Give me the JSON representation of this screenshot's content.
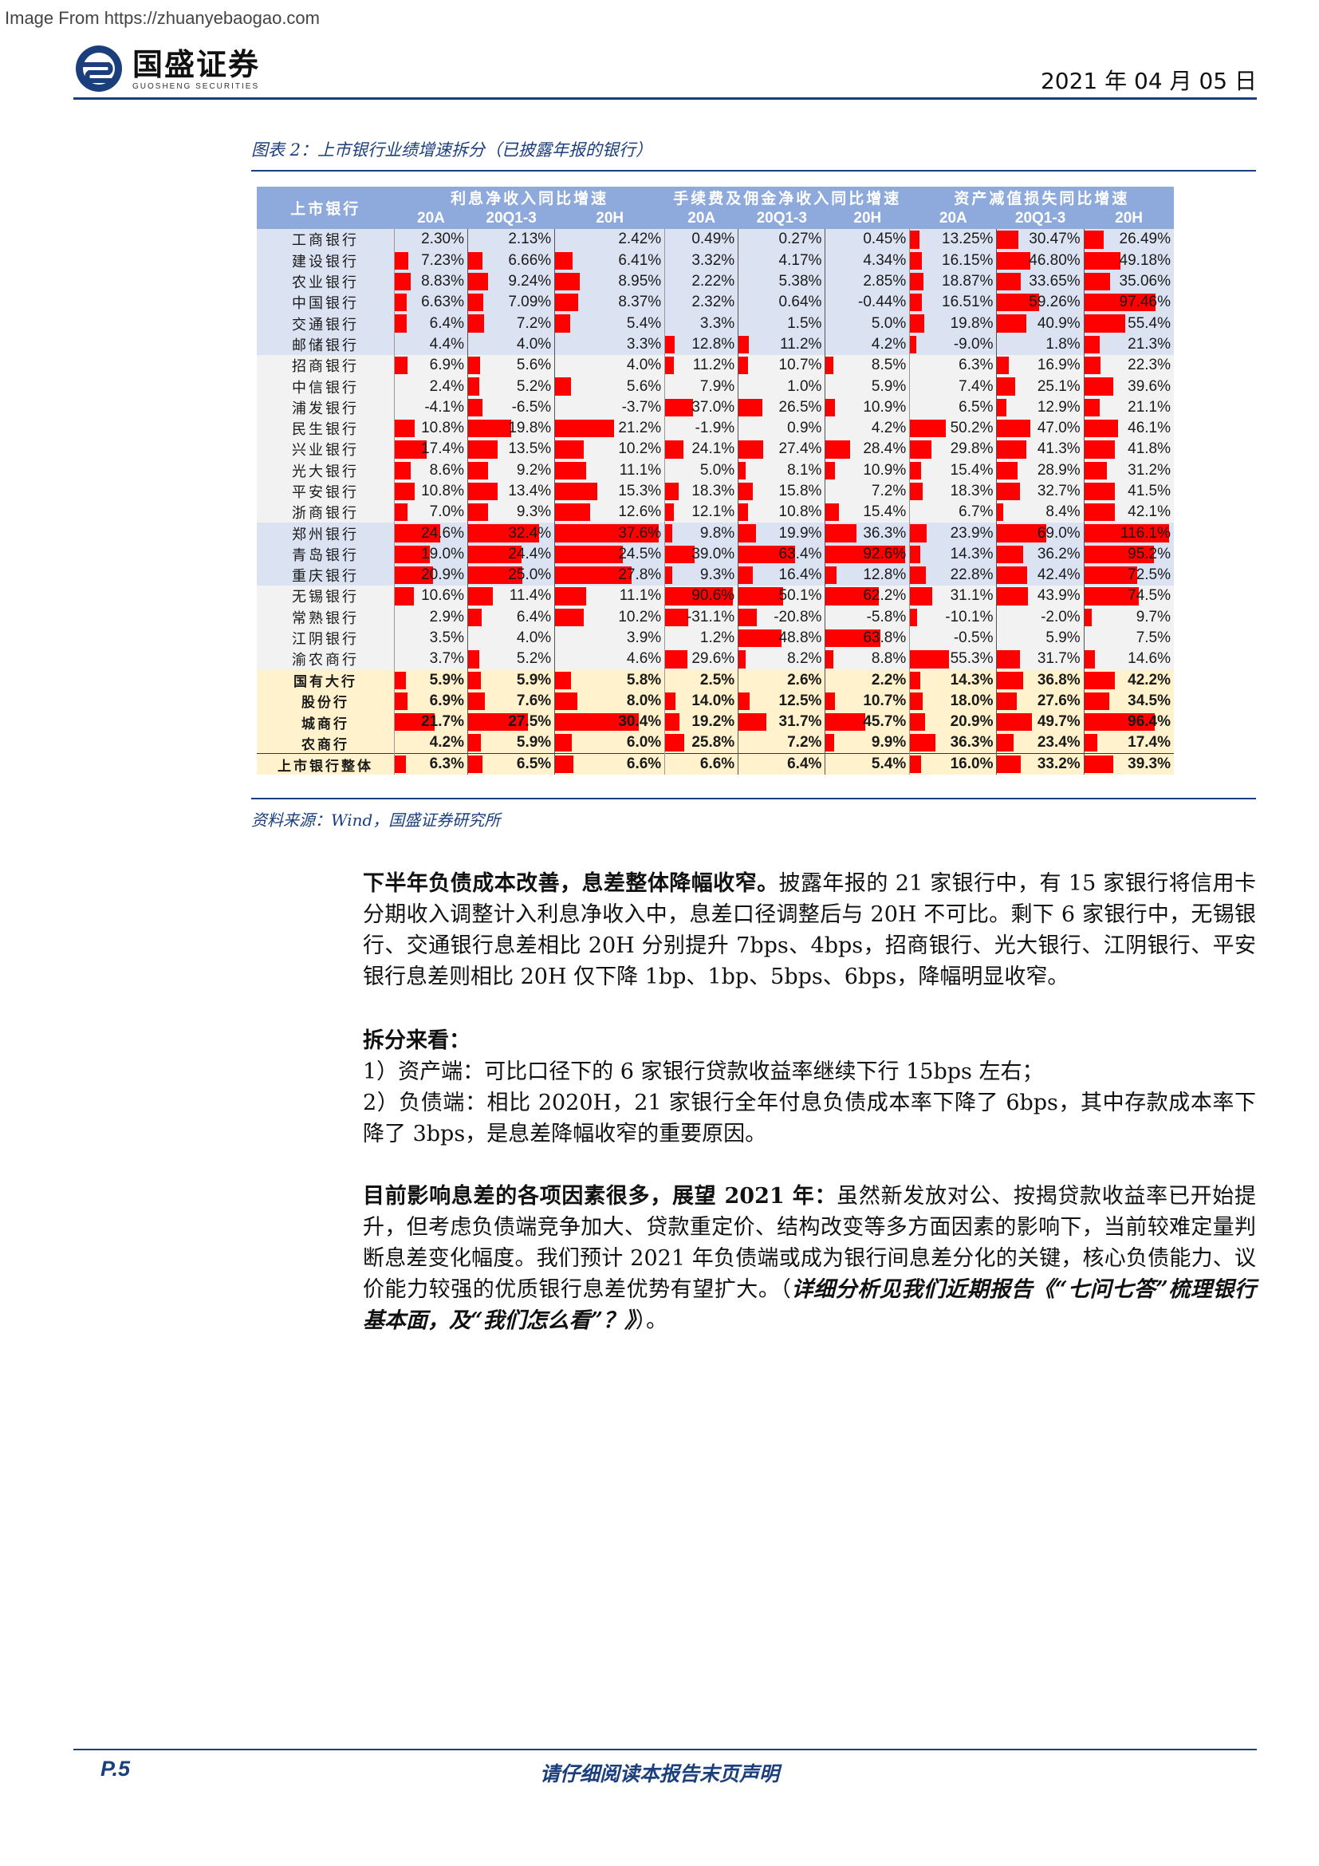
{
  "watermark": "Image From https://zhuanyebaogao.com",
  "header": {
    "logo_cn": "国盛证券",
    "logo_en": "GUOSHENG SECURITIES",
    "date": "2021 年 04 月 05 日",
    "brand_color": "#1b3f7d"
  },
  "figure": {
    "title": "图表 2：上市银行业绩增速拆分（已披露年报的银行）",
    "source": "资料来源：Wind，国盛证券研究所"
  },
  "table": {
    "row_header": "上市银行",
    "groups": [
      "利息净收入同比增速",
      "手续费及佣金净收入同比增速",
      "资产减值损失同比增速"
    ],
    "sub_headers": [
      "20A",
      "20Q1-3",
      "20H",
      "20A",
      "20Q1-3",
      "20H",
      "20A",
      "20Q1-3",
      "20H"
    ],
    "bar_color": "#ff0000",
    "rows": [
      {
        "name": "工商银行",
        "g": "g1",
        "v": [
          "2.30%",
          "2.13%",
          "2.42%",
          "0.49%",
          "0.27%",
          "0.45%",
          "13.25%",
          "30.47%",
          "26.49%"
        ],
        "n": [
          2.3,
          2.13,
          2.42,
          0.49,
          0.27,
          0.45,
          13.25,
          30.47,
          26.49
        ]
      },
      {
        "name": "建设银行",
        "g": "g1",
        "v": [
          "7.23%",
          "6.66%",
          "6.41%",
          "3.32%",
          "4.17%",
          "4.34%",
          "16.15%",
          "46.80%",
          "49.18%"
        ],
        "n": [
          7.23,
          6.66,
          6.41,
          3.32,
          4.17,
          4.34,
          16.15,
          46.8,
          49.18
        ]
      },
      {
        "name": "农业银行",
        "g": "g1",
        "v": [
          "8.83%",
          "9.24%",
          "8.95%",
          "2.22%",
          "5.38%",
          "2.85%",
          "18.87%",
          "33.65%",
          "35.06%"
        ],
        "n": [
          8.83,
          9.24,
          8.95,
          2.22,
          5.38,
          2.85,
          18.87,
          33.65,
          35.06
        ]
      },
      {
        "name": "中国银行",
        "g": "g1",
        "v": [
          "6.63%",
          "7.09%",
          "8.37%",
          "2.32%",
          "0.64%",
          "-0.44%",
          "16.51%",
          "59.26%",
          "97.46%"
        ],
        "n": [
          6.63,
          7.09,
          8.37,
          2.32,
          0.64,
          -0.44,
          16.51,
          59.26,
          97.46
        ]
      },
      {
        "name": "交通银行",
        "g": "g1",
        "v": [
          "6.4%",
          "7.2%",
          "5.4%",
          "3.3%",
          "1.5%",
          "5.0%",
          "19.8%",
          "40.9%",
          "55.4%"
        ],
        "n": [
          6.4,
          7.2,
          5.4,
          3.3,
          1.5,
          5.0,
          19.8,
          40.9,
          55.4
        ]
      },
      {
        "name": "邮储银行",
        "g": "g1",
        "v": [
          "4.4%",
          "4.0%",
          "3.3%",
          "12.8%",
          "11.2%",
          "4.2%",
          "-9.0%",
          "1.8%",
          "21.3%"
        ],
        "n": [
          4.4,
          4.0,
          3.3,
          12.8,
          11.2,
          4.2,
          -9.0,
          1.8,
          21.3
        ]
      },
      {
        "name": "招商银行",
        "g": "g2",
        "v": [
          "6.9%",
          "5.6%",
          "4.0%",
          "11.2%",
          "10.7%",
          "8.5%",
          "6.3%",
          "16.9%",
          "22.3%"
        ],
        "n": [
          6.9,
          5.6,
          4.0,
          11.2,
          10.7,
          8.5,
          6.3,
          16.9,
          22.3
        ]
      },
      {
        "name": "中信银行",
        "g": "g2",
        "v": [
          "2.4%",
          "5.2%",
          "5.6%",
          "7.9%",
          "1.0%",
          "5.9%",
          "7.4%",
          "25.1%",
          "39.6%"
        ],
        "n": [
          2.4,
          5.2,
          5.6,
          7.9,
          1.0,
          5.9,
          7.4,
          25.1,
          39.6
        ]
      },
      {
        "name": "浦发银行",
        "g": "g2",
        "v": [
          "-4.1%",
          "-6.5%",
          "-3.7%",
          "37.0%",
          "26.5%",
          "10.9%",
          "6.5%",
          "12.9%",
          "21.1%"
        ],
        "n": [
          -4.1,
          -6.5,
          -3.7,
          37.0,
          26.5,
          10.9,
          6.5,
          12.9,
          21.1
        ]
      },
      {
        "name": "民生银行",
        "g": "g2",
        "v": [
          "10.8%",
          "19.8%",
          "21.2%",
          "-1.9%",
          "0.9%",
          "4.2%",
          "50.2%",
          "47.0%",
          "46.1%"
        ],
        "n": [
          10.8,
          19.8,
          21.2,
          -1.9,
          0.9,
          4.2,
          50.2,
          47.0,
          46.1
        ]
      },
      {
        "name": "兴业银行",
        "g": "g2",
        "v": [
          "17.4%",
          "13.5%",
          "10.2%",
          "24.1%",
          "27.4%",
          "28.4%",
          "29.8%",
          "41.3%",
          "41.8%"
        ],
        "n": [
          17.4,
          13.5,
          10.2,
          24.1,
          27.4,
          28.4,
          29.8,
          41.3,
          41.8
        ]
      },
      {
        "name": "光大银行",
        "g": "g2",
        "v": [
          "8.6%",
          "9.2%",
          "11.1%",
          "5.0%",
          "8.1%",
          "10.9%",
          "15.4%",
          "28.9%",
          "31.2%"
        ],
        "n": [
          8.6,
          9.2,
          11.1,
          5.0,
          8.1,
          10.9,
          15.4,
          28.9,
          31.2
        ]
      },
      {
        "name": "平安银行",
        "g": "g2",
        "v": [
          "10.8%",
          "13.4%",
          "15.3%",
          "18.3%",
          "15.8%",
          "7.2%",
          "18.3%",
          "32.7%",
          "41.5%"
        ],
        "n": [
          10.8,
          13.4,
          15.3,
          18.3,
          15.8,
          7.2,
          18.3,
          32.7,
          41.5
        ]
      },
      {
        "name": "浙商银行",
        "g": "g2",
        "v": [
          "7.0%",
          "9.3%",
          "12.6%",
          "12.1%",
          "10.8%",
          "15.4%",
          "6.7%",
          "8.4%",
          "42.1%"
        ],
        "n": [
          7.0,
          9.3,
          12.6,
          12.1,
          10.8,
          15.4,
          6.7,
          8.4,
          42.1
        ]
      },
      {
        "name": "郑州银行",
        "g": "g3",
        "v": [
          "24.6%",
          "32.4%",
          "37.6%",
          "9.8%",
          "19.9%",
          "36.3%",
          "23.9%",
          "69.0%",
          "116.1%"
        ],
        "n": [
          24.6,
          32.4,
          37.6,
          9.8,
          19.9,
          36.3,
          23.9,
          69.0,
          116.1
        ]
      },
      {
        "name": "青岛银行",
        "g": "g3",
        "v": [
          "19.0%",
          "24.4%",
          "24.5%",
          "39.0%",
          "63.4%",
          "92.6%",
          "14.3%",
          "36.2%",
          "95.2%"
        ],
        "n": [
          19.0,
          24.4,
          24.5,
          39.0,
          63.4,
          92.6,
          14.3,
          36.2,
          95.2
        ]
      },
      {
        "name": "重庆银行",
        "g": "g3",
        "v": [
          "20.9%",
          "25.0%",
          "27.8%",
          "9.3%",
          "16.4%",
          "12.8%",
          "22.8%",
          "42.4%",
          "72.5%"
        ],
        "n": [
          20.9,
          25.0,
          27.8,
          9.3,
          16.4,
          12.8,
          22.8,
          42.4,
          72.5
        ]
      },
      {
        "name": "无锡银行",
        "g": "g4",
        "v": [
          "10.6%",
          "11.4%",
          "11.1%",
          "90.6%",
          "50.1%",
          "62.2%",
          "31.1%",
          "43.9%",
          "74.5%"
        ],
        "n": [
          10.6,
          11.4,
          11.1,
          90.6,
          50.1,
          62.2,
          31.1,
          43.9,
          74.5
        ]
      },
      {
        "name": "常熟银行",
        "g": "g4",
        "v": [
          "2.9%",
          "6.4%",
          "10.2%",
          "-31.1%",
          "-20.8%",
          "-5.8%",
          "-10.1%",
          "-2.0%",
          "9.7%"
        ],
        "n": [
          2.9,
          6.4,
          10.2,
          -31.1,
          -20.8,
          -5.8,
          -10.1,
          -2.0,
          9.7
        ]
      },
      {
        "name": "江阴银行",
        "g": "g4",
        "v": [
          "3.5%",
          "4.0%",
          "3.9%",
          "1.2%",
          "48.8%",
          "63.8%",
          "-0.5%",
          "5.9%",
          "7.5%"
        ],
        "n": [
          3.5,
          4.0,
          3.9,
          1.2,
          48.8,
          63.8,
          -0.5,
          5.9,
          7.5
        ]
      },
      {
        "name": "渝农商行",
        "g": "g4",
        "v": [
          "3.7%",
          "5.2%",
          "4.6%",
          "29.6%",
          "8.2%",
          "8.8%",
          "55.3%",
          "31.7%",
          "14.6%"
        ],
        "n": [
          3.7,
          5.2,
          4.6,
          29.6,
          8.2,
          8.8,
          55.3,
          31.7,
          14.6
        ]
      },
      {
        "name": "国有大行",
        "g": "sum",
        "v": [
          "5.9%",
          "5.9%",
          "5.8%",
          "2.5%",
          "2.6%",
          "2.2%",
          "14.3%",
          "36.8%",
          "42.2%"
        ],
        "n": [
          5.9,
          5.9,
          5.8,
          2.5,
          2.6,
          2.2,
          14.3,
          36.8,
          42.2
        ]
      },
      {
        "name": "股份行",
        "g": "sum",
        "v": [
          "6.9%",
          "7.6%",
          "8.0%",
          "14.0%",
          "12.5%",
          "10.7%",
          "18.0%",
          "27.6%",
          "34.5%"
        ],
        "n": [
          6.9,
          7.6,
          8.0,
          14.0,
          12.5,
          10.7,
          18.0,
          27.6,
          34.5
        ]
      },
      {
        "name": "城商行",
        "g": "sum",
        "v": [
          "21.7%",
          "27.5%",
          "30.4%",
          "19.2%",
          "31.7%",
          "45.7%",
          "20.9%",
          "49.7%",
          "96.4%"
        ],
        "n": [
          21.7,
          27.5,
          30.4,
          19.2,
          31.7,
          45.7,
          20.9,
          49.7,
          96.4
        ]
      },
      {
        "name": "农商行",
        "g": "sum",
        "v": [
          "4.2%",
          "5.9%",
          "6.0%",
          "25.8%",
          "7.2%",
          "9.9%",
          "36.3%",
          "23.4%",
          "17.4%"
        ],
        "n": [
          4.2,
          5.9,
          6.0,
          25.8,
          7.2,
          9.9,
          36.3,
          23.4,
          17.4
        ]
      },
      {
        "name": "上市银行整体",
        "g": "sum total",
        "v": [
          "6.3%",
          "6.5%",
          "6.6%",
          "6.6%",
          "6.4%",
          "5.4%",
          "16.0%",
          "33.2%",
          "39.3%"
        ],
        "n": [
          6.3,
          6.5,
          6.6,
          6.6,
          6.4,
          5.4,
          16.0,
          33.2,
          39.3
        ]
      }
    ]
  },
  "paragraphs": {
    "p1_bold": "下半年负债成本改善，息差整体降幅收窄。",
    "p1_text": "披露年报的 21 家银行中，有 15 家银行将信用卡分期收入调整计入利息净收入中，息差口径调整后与 20H 不可比。剩下 6 家银行中，无锡银行、交通银行息差相比 20H 分别提升 7bps、4bps，招商银行、光大银行、江阴银行、平安银行息差则相比 20H 仅下降 1bp、1bp、5bps、6bps，降幅明显收窄。",
    "p2_bold": "拆分来看：",
    "p2_l1": "1）资产端：可比口径下的 6 家银行贷款收益率继续下行 15bps 左右；",
    "p2_l2": "2）负债端：相比 2020H，21 家银行全年付息负债成本率下降了 6bps，其中存款成本率下降了 3bps，是息差降幅收窄的重要原因。",
    "p3_bold": "目前影响息差的各项因素很多，展望 2021 年：",
    "p3_text": "虽然新发放对公、按揭贷款收益率已开始提升，但考虑负债端竞争加大、贷款重定价、结构改变等多方面因素的影响下，当前较难定量判断息差变化幅度。我们预计 2021 年负债端或成为银行间息差分化的关键，核心负债能力、议价能力较强的优质银行息差优势有望扩大。（",
    "p3_italic": "详细分析见我们近期报告《“七问七答”梳理银行基本面，及“我们怎么看”？》",
    "p3_end": "）。"
  },
  "footer": {
    "page": "P.5",
    "note": "请仔细阅读本报告末页声明"
  }
}
